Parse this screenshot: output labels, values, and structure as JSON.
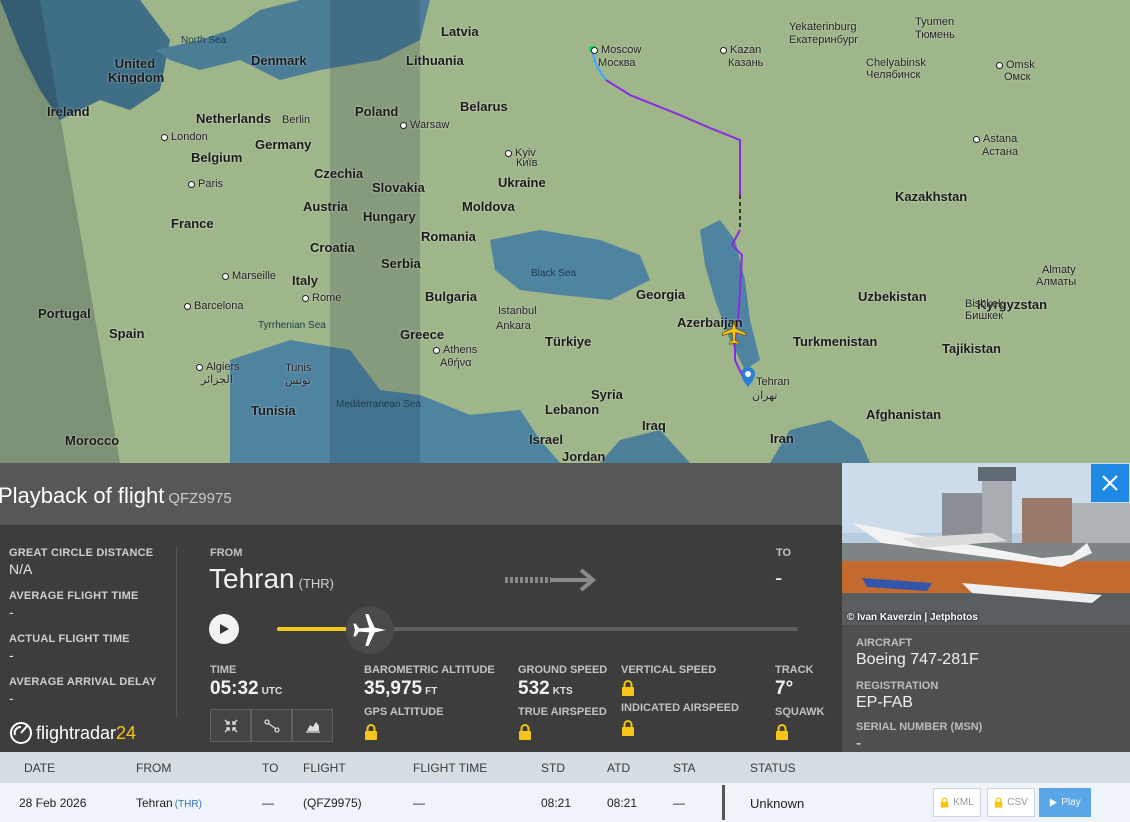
{
  "map": {
    "countries": [
      "Latvia",
      "Lithuania",
      "United Kingdom",
      "Ireland",
      "Denmark",
      "Netherlands",
      "Belgium",
      "Germany",
      "France",
      "Poland",
      "Belarus",
      "Czechia",
      "Slovakia",
      "Austria",
      "Hungary",
      "Ukraine",
      "Moldova",
      "Romania",
      "Croatia",
      "Serbia",
      "Italy",
      "Bulgaria",
      "Spain",
      "Portugal",
      "Greece",
      "Türkiye",
      "Georgia",
      "Azerbaijan",
      "Turkmenistan",
      "Kazakhstan",
      "Uzbekistan",
      "Kyrgyzstan",
      "Tajikistan",
      "Afghanistan",
      "Iran",
      "Iraq",
      "Syria",
      "Lebanon",
      "Israel",
      "Jordan",
      "Tunisia",
      "Morocco"
    ],
    "cities": [
      "Moscow",
      "Москва",
      "Kazan",
      "Казань",
      "Yekaterinburg",
      "Екатеринбург",
      "Tyumen",
      "Тюмень",
      "Chelyabinsk",
      "Челябинск",
      "Omsk",
      "Омск",
      "Astana",
      "Астана",
      "Kyiv",
      "Київ",
      "Berlin",
      "Warsaw",
      "London",
      "Paris",
      "Marseille",
      "Barcelona",
      "Rome",
      "Istanbul",
      "Ankara",
      "Athens",
      "Αθήνα",
      "Tehran",
      "تهران",
      "Bishkek",
      "Бишкек",
      "Almaty",
      "Алматы",
      "Algiers",
      "الجزائر",
      "Tunis",
      "تونس"
    ],
    "seas": [
      "North Sea",
      "Black Sea",
      "Tyrrhenian Sea",
      "Mediterranean Sea"
    ],
    "route_color": "#8a2be2"
  },
  "panel": {
    "title": "Playback of flight",
    "flight_code": "QFZ9975",
    "stats": [
      {
        "label": "GREAT CIRCLE DISTANCE",
        "value": "N/A"
      },
      {
        "label": "AVERAGE FLIGHT TIME",
        "value": "-"
      },
      {
        "label": "ACTUAL FLIGHT TIME",
        "value": "-"
      },
      {
        "label": "AVERAGE ARRIVAL DELAY",
        "value": "-"
      }
    ],
    "from_label": "FROM",
    "from_city": "Tehran",
    "from_code": "(THR)",
    "to_label": "TO",
    "to_city": "-",
    "progress": 0.16,
    "metrics": {
      "time_label": "TIME",
      "time_value": "05:32",
      "time_unit": "UTC",
      "baro_label": "BAROMETRIC ALTITUDE",
      "baro_value": "35,975",
      "baro_unit": "FT",
      "gps_label": "GPS ALTITUDE",
      "gs_label": "GROUND SPEED",
      "gs_value": "532",
      "gs_unit": "KTS",
      "tas_label": "TRUE AIRSPEED",
      "vs_label": "VERTICAL SPEED",
      "ias_label": "INDICATED AIRSPEED",
      "track_label": "TRACK",
      "track_value": "7°",
      "squawk_label": "SQUAWK"
    },
    "logo_text": "flightradar",
    "logo_num": "24"
  },
  "aircraft": {
    "photo_credit": "© Ivan Kaverzin | Jetphotos",
    "aircraft_label": "AIRCRAFT",
    "aircraft_value": "Boeing 747-281F",
    "registration_label": "REGISTRATION",
    "registration_value": "EP-FAB",
    "serial_label": "SERIAL NUMBER (MSN)",
    "serial_value": "-"
  },
  "table": {
    "headers": [
      "DATE",
      "FROM",
      "TO",
      "FLIGHT",
      "FLIGHT TIME",
      "STD",
      "ATD",
      "STA",
      "STATUS"
    ],
    "row": {
      "date": "28 Feb 2026",
      "from": "Tehran",
      "from_code": "(THR)",
      "to": "—",
      "flight": "(QFZ9975)",
      "flight_time": "—",
      "std": "08:21",
      "atd": "08:21",
      "sta": "—",
      "status": "Unknown"
    },
    "buttons": {
      "kml": "KML",
      "csv": "CSV",
      "play": "Play"
    }
  }
}
